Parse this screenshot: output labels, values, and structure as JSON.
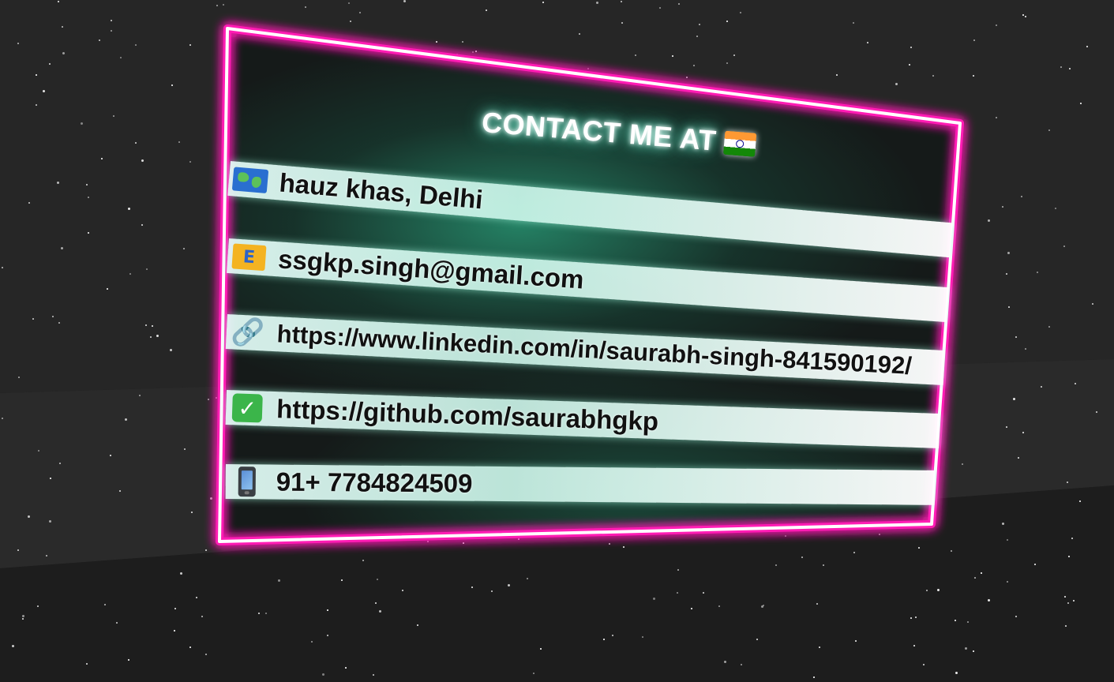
{
  "card": {
    "title": "CONTACT ME AT",
    "title_flag_icon": "india-flag-icon",
    "glow_outer": "#ff1fb4",
    "glow_inner": "#ffffff",
    "accent_green": "#2fd3a4"
  },
  "contacts": [
    {
      "icon": "world-map-icon",
      "text": "hauz khas, Delhi"
    },
    {
      "icon": "e-mail-icon",
      "text": "ssgkp.singh@gmail.com"
    },
    {
      "icon": "link-icon",
      "text": "https://www.linkedin.com/in/saurabh-singh-841590192/"
    },
    {
      "icon": "check-mark-icon",
      "text": "https://github.com/saurabhgkp"
    },
    {
      "icon": "mobile-phone-icon",
      "text": "91+ 7784824509"
    }
  ]
}
